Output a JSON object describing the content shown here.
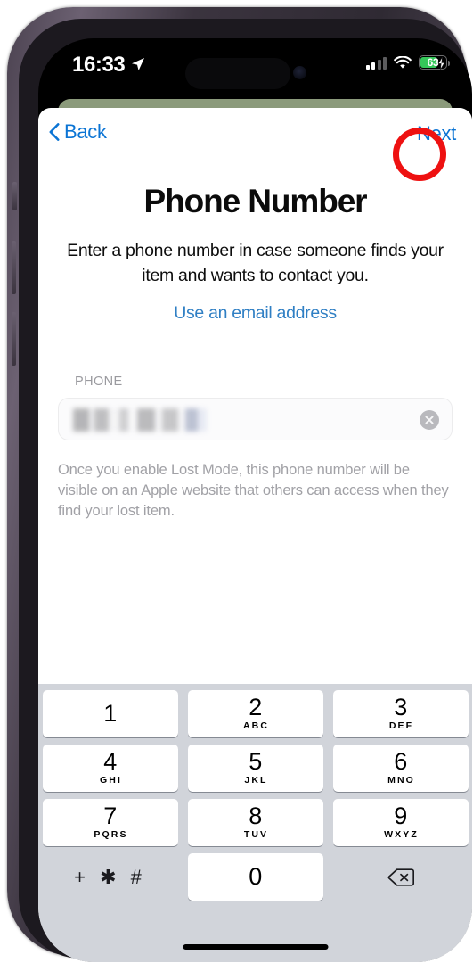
{
  "status_bar": {
    "time": "16:33",
    "location_icon": "location-arrow-icon",
    "signal_icon": "cellular-signal-icon",
    "wifi_icon": "wifi-icon",
    "battery_percent": "63",
    "battery_charging": true,
    "battery_color": "#34c759"
  },
  "nav": {
    "back_label": "Back",
    "next_label": "Next",
    "tint_color": "#0b74d4",
    "annotation_color": "#ee1111"
  },
  "main": {
    "title": "Phone Number",
    "subtitle": "Enter a phone number in case someone finds your item and wants to contact you.",
    "email_link": "Use an email address",
    "field_label": "PHONE",
    "field_value": "",
    "field_value_redacted": true,
    "clear_icon": "clear-circle-icon",
    "footnote": "Once you enable Lost Mode, this phone number will be visible on an Apple website that others can access when they find your lost item."
  },
  "keypad": {
    "background_color": "#d1d4da",
    "rows": [
      [
        {
          "digit": "1",
          "letters": ""
        },
        {
          "digit": "2",
          "letters": "ABC"
        },
        {
          "digit": "3",
          "letters": "DEF"
        }
      ],
      [
        {
          "digit": "4",
          "letters": "GHI"
        },
        {
          "digit": "5",
          "letters": "JKL"
        },
        {
          "digit": "6",
          "letters": "MNO"
        }
      ],
      [
        {
          "digit": "7",
          "letters": "PQRS"
        },
        {
          "digit": "8",
          "letters": "TUV"
        },
        {
          "digit": "9",
          "letters": "WXYZ"
        }
      ]
    ],
    "bottom_row": {
      "symbols": "+ ✱ #",
      "zero": "0",
      "backspace_icon": "backspace-delete-icon"
    }
  },
  "home_indicator": "home-indicator-bar"
}
